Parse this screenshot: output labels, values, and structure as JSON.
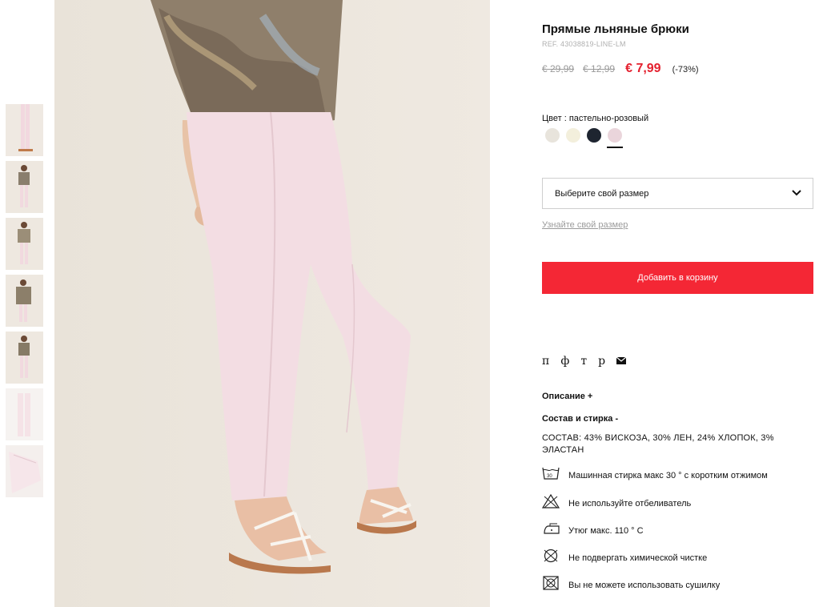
{
  "product": {
    "title": "Прямые льняные брюки",
    "ref": "REF. 43038819-LINE-LM",
    "prices": {
      "original": "€ 29,99",
      "previous": "€ 12,99",
      "current": "€ 7,99",
      "discount": "(-73%)"
    },
    "color_label": "Цвет : пастельно-розовый",
    "swatches": [
      {
        "name": "beige",
        "hex": "#e8e4dc"
      },
      {
        "name": "cream",
        "hex": "#f3efdc"
      },
      {
        "name": "navy",
        "hex": "#1e2530"
      },
      {
        "name": "pastel-pink",
        "hex": "#ead5db",
        "selected": true
      }
    ],
    "size_select": {
      "placeholder": "Выберите свой размер"
    },
    "size_guide_link": "Узнайте свой размер",
    "add_to_cart": "Добавить в корзину"
  },
  "share": {
    "icons": [
      "п",
      "ф",
      "т",
      "р"
    ],
    "email_icon": "envelope-icon"
  },
  "sections": {
    "description": "Описание +",
    "composition": "Состав и стирка -"
  },
  "composition_text": "СОСТАВ: 43% ВИСКОЗА, 30% ЛЕН, 24% ХЛОПОК, 3% ЭЛАСТАН",
  "care": [
    {
      "icon": "wash-30-icon",
      "text": "Машинная стирка макс 30 ° с коротким отжимом"
    },
    {
      "icon": "no-bleach-icon",
      "text": "Не используйте отбеливатель"
    },
    {
      "icon": "iron-110-icon",
      "text": "Утюг макс. 110 ° C"
    },
    {
      "icon": "no-dry-clean-icon",
      "text": "Не подвергать химической чистке"
    },
    {
      "icon": "no-tumble-dry-icon",
      "text": "Вы не можете использовать сушилку"
    }
  ],
  "thumbnails_count": 7,
  "colors": {
    "accent": "#f42735",
    "sale_price": "#e4202e",
    "pants": "#f3dde3",
    "background": "#ece6de"
  }
}
